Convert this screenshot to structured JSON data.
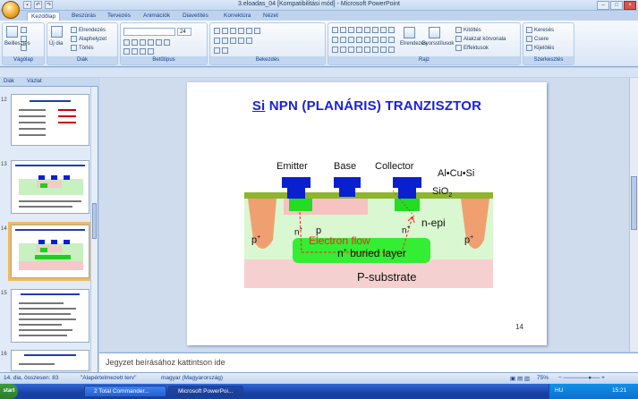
{
  "window": {
    "title": "3.eloadas_04 [Kompatibilitási mód] - Microsoft PowerPoint"
  },
  "ribbon": {
    "tabs": [
      "Kezdőlap",
      "Beszúrás",
      "Tervezés",
      "Animációk",
      "Diavetítés",
      "Korrektúra",
      "Nézet"
    ],
    "active_tab": "Kezdőlap",
    "groups": {
      "clipboard": {
        "label": "Vágólap",
        "paste": "Beillesztés"
      },
      "slides": {
        "label": "Diák",
        "new_slide": "Új dia",
        "layout": "Elrendezés",
        "reset": "Alaphelyzet",
        "delete": "Törlés"
      },
      "font": {
        "label": "Betűtípus",
        "font_name": "",
        "font_size": "24"
      },
      "paragraph": {
        "label": "Bekezdés"
      },
      "drawing": {
        "label": "Rajz",
        "arrange": "Elrendezés",
        "quick_styles": "Gyorsstílusok",
        "shape_fill": "Kitöltés",
        "shape_outline": "Alakzat körvonala",
        "shape_effects": "Effektusok"
      },
      "editing": {
        "label": "Szerkesztés",
        "find": "Keresés",
        "replace": "Csere",
        "select": "Kijelölés"
      }
    }
  },
  "left_pane": {
    "tabs": [
      "Diák",
      "Vázlat"
    ],
    "slides": [
      {
        "number": "12",
        "title": "TTL SOROZATOK"
      },
      {
        "number": "13",
        "title": "Si NPN (PLANÁRIS) TRANZISZTOR"
      },
      {
        "number": "14",
        "title": "Si NPN (PLANÁRIS) TRANZISZTOR",
        "selected": true
      },
      {
        "number": "15",
        "title": ""
      },
      {
        "number": "16",
        "title": "Bipoláris integrált áramkörök"
      }
    ]
  },
  "slide": {
    "title_prefix": "Si",
    "title_rest": " NPN (PLANÁRIS) TRANZISZTOR",
    "number": "14",
    "diagram": {
      "labels": {
        "emitter": "Emitter",
        "base": "Base",
        "collector": "Collector",
        "metal": "Al•Cu•Si",
        "oxide": "SiO",
        "oxide_sub": "2",
        "p_plus": "p",
        "p_plus_sup": "+",
        "n_plus_e": "n",
        "n_plus_e_sup": "+",
        "p_base": "p",
        "n_plus_c": "n",
        "n_plus_c_sup": "+",
        "n_epi": "n-epi",
        "electron_flow": "Electron flow",
        "buried": "n",
        "buried_sup": "+",
        "buried_rest": " buried layer",
        "substrate": "P-substrate"
      },
      "colors": {
        "metal": "#0a20d0",
        "oxide": "#8db52e",
        "n_epi": "#d9f7d0",
        "p_base": "#f6c2c2",
        "n_plus": "#22dd22",
        "p_plus": "#f0a070",
        "substrate": "#f6d0d0",
        "electron_flow": "#ff2020"
      }
    }
  },
  "notes": {
    "placeholder": "Jegyzet beírásához kattintson ide"
  },
  "status": {
    "slide_info": "14. dia, összesen: 83",
    "theme": "\"Alapértelmezett terv\"",
    "language": "magyar (Magyarország)",
    "zoom": "75%"
  },
  "taskbar": {
    "start": "start",
    "items": [
      "2 Total Commander...",
      "Microsoft PowerPoi..."
    ],
    "clock": "15:21",
    "lang": "HU"
  }
}
